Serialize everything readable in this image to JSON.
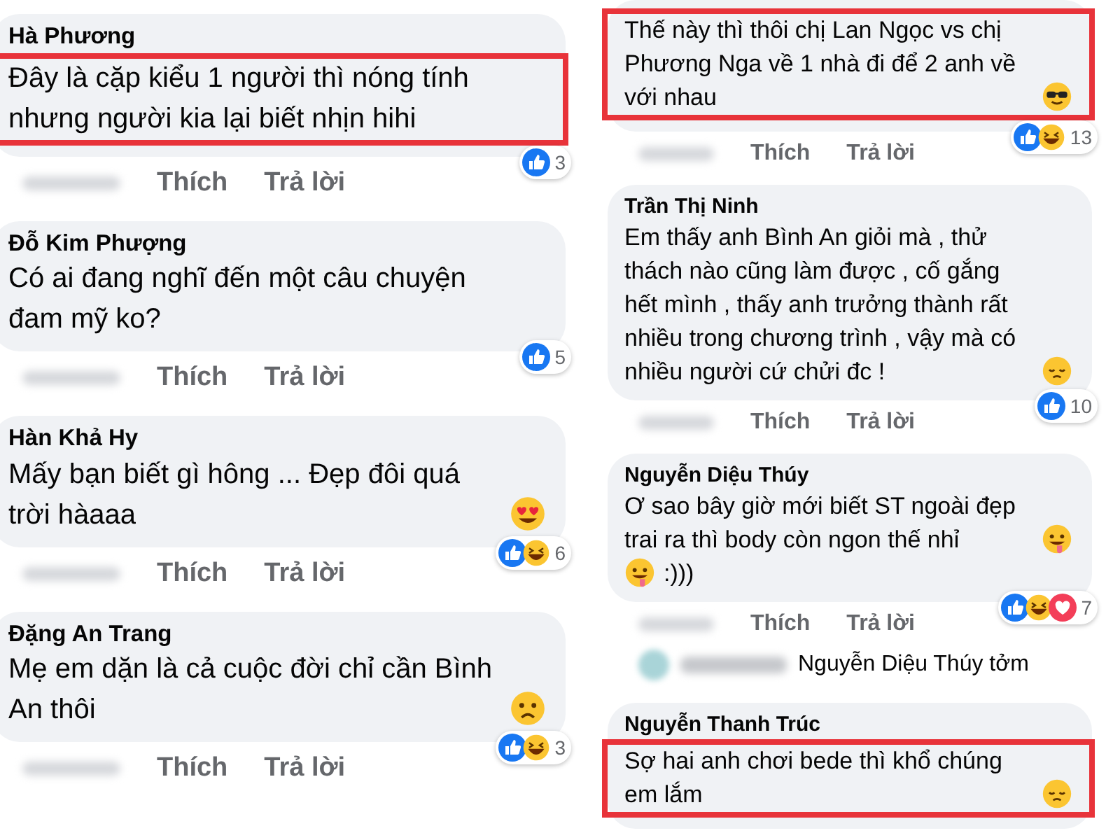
{
  "columns": [
    {
      "comments": [
        {
          "name": "Hà Phương",
          "segments": [
            {
              "kind": "text",
              "text": "Đây là cặp kiểu 1 người thì nóng tính nhưng người kia lại biết nhịn hihi"
            }
          ],
          "highlighted": true,
          "like_label": "Thích",
          "reply_label": "Trả lời",
          "reactions": {
            "items": [
              {
                "kind": "like"
              }
            ],
            "count": "3"
          }
        },
        {
          "name": "Đỗ Kim Phượng",
          "segments": [
            {
              "kind": "text",
              "text": "Có ai đang nghĩ đến một câu chuyện đam mỹ ko?"
            }
          ],
          "highlighted": false,
          "like_label": "Thích",
          "reply_label": "Trả lời",
          "reactions": {
            "items": [
              {
                "kind": "like"
              }
            ],
            "count": "5"
          }
        },
        {
          "name": "Hàn Khả Hy",
          "segments": [
            {
              "kind": "text",
              "text": "Mấy bạn biết gì hông ... Đẹp đôi quá trời hàaaa"
            },
            {
              "kind": "heart-eyes"
            }
          ],
          "highlighted": false,
          "like_label": "Thích",
          "reply_label": "Trả lời",
          "reactions": {
            "items": [
              {
                "kind": "like"
              },
              {
                "kind": "haha"
              }
            ],
            "count": "6"
          }
        },
        {
          "name": "Đặng An Trang",
          "segments": [
            {
              "kind": "text",
              "text": "Mẹ em dặn là cả cuộc đời chỉ cần Bình An thôi"
            },
            {
              "kind": "frown"
            }
          ],
          "highlighted": false,
          "like_label": "Thích",
          "reply_label": "Trả lời",
          "reactions": {
            "items": [
              {
                "kind": "like"
              },
              {
                "kind": "haha"
              }
            ],
            "count": "3"
          }
        }
      ]
    },
    {
      "comments": [
        {
          "segments": [
            {
              "kind": "text",
              "text": "Thế này thì thôi chị Lan Ngọc vs chị Phương Nga về 1 nhà đi để 2 anh về với nhau"
            },
            {
              "kind": "sunglasses"
            }
          ],
          "highlighted": true,
          "like_label": "Thích",
          "reply_label": "Trả lời",
          "reactions": {
            "items": [
              {
                "kind": "like"
              },
              {
                "kind": "haha"
              }
            ],
            "count": "13"
          }
        },
        {
          "name": "Trần Thị Ninh",
          "segments": [
            {
              "kind": "text",
              "text": "Em thấy anh Bình An giỏi mà , thử thách nào cũng làm được , cố gắng hết mình , thấy anh trưởng thành rất nhiều trong chương trình , vậy mà có nhiều người cứ chửi đc !"
            },
            {
              "kind": "pensive"
            }
          ],
          "highlighted": false,
          "like_label": "Thích",
          "reply_label": "Trả lời",
          "reactions": {
            "items": [
              {
                "kind": "like"
              }
            ],
            "count": "10"
          }
        },
        {
          "name": "Nguyễn Diệu Thúy",
          "segments": [
            {
              "kind": "text",
              "text": "Ơ sao bây giờ mới biết ST ngoài đẹp trai ra thì body còn ngon thế nhỉ"
            },
            {
              "kind": "drool"
            },
            {
              "kind": "drool"
            },
            {
              "kind": "text",
              "text": ":)))"
            }
          ],
          "highlighted": false,
          "like_label": "Thích",
          "reply_label": "Trả lời",
          "reactions": {
            "items": [
              {
                "kind": "like"
              },
              {
                "kind": "haha"
              },
              {
                "kind": "love"
              }
            ],
            "count": "7"
          },
          "replies": [
            {
              "text": "Nguyễn Diệu Thúy tởm"
            }
          ]
        },
        {
          "name": "Nguyễn Thanh Trúc",
          "segments": [
            {
              "kind": "text",
              "text": "Sợ hai anh chơi bede thì khổ chúng em lắm"
            },
            {
              "kind": "pensive"
            }
          ],
          "highlighted": true
        }
      ]
    }
  ]
}
